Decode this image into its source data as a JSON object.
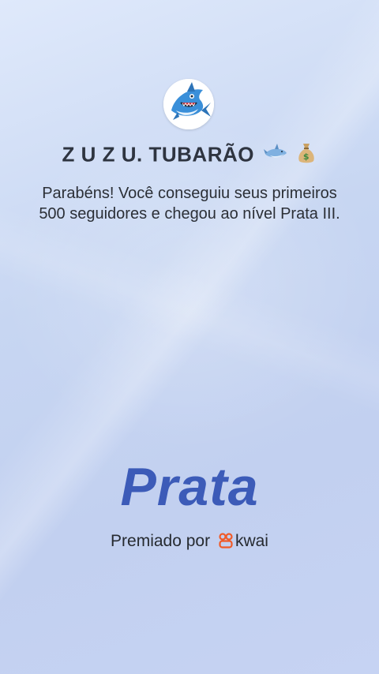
{
  "profile": {
    "name": "Z U Z U. TUBARÃO",
    "name_emoji_icons": [
      "shark-emoji-icon",
      "money-bag-emoji-icon"
    ]
  },
  "message": {
    "text": "Parabéns! Você conseguiu seus primeiros 500 seguidores e chegou ao nível Prata III."
  },
  "level": {
    "label": "Prata"
  },
  "awarded": {
    "prefix": "Premiado por",
    "brand": "kwai"
  },
  "colors": {
    "level_text": "#3c5bb8",
    "kwai_brand": "#f05a28",
    "background_top": "#dfe9fb",
    "background_bottom": "#c6d3f3"
  }
}
